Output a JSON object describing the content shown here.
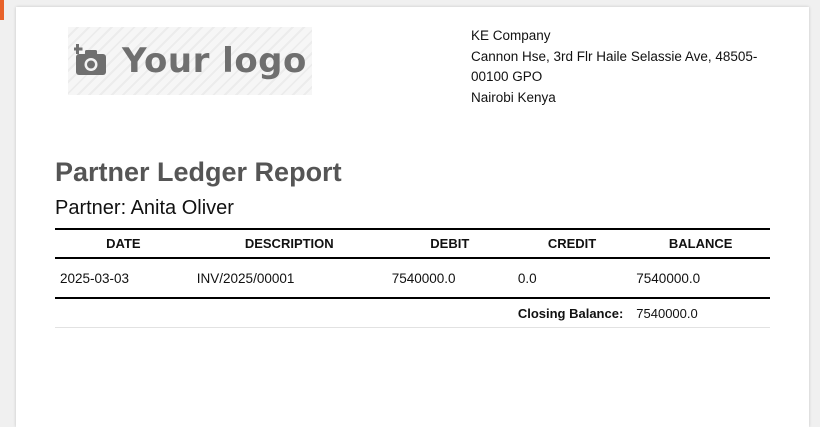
{
  "logo": {
    "text": "Your logo",
    "icon": "camera-plus-icon"
  },
  "company": {
    "name": "KE Company",
    "address_line1": "Cannon Hse, 3rd Flr Haile Selassie Ave, 48505-00100 GPO",
    "address_line2": "Nairobi Kenya"
  },
  "report": {
    "title": "Partner Ledger Report",
    "partner": "Partner: Anita Oliver"
  },
  "table": {
    "headers": [
      "DATE",
      "DESCRIPTION",
      "DEBIT",
      "CREDIT",
      "BALANCE"
    ],
    "rows": [
      {
        "date": "2025-03-03",
        "description": "INV/2025/00001",
        "debit": "7540000.0",
        "credit": "0.0",
        "balance": "7540000.0"
      }
    ],
    "closing_label": "Closing Balance:",
    "closing_value": "7540000.0"
  },
  "colors": {
    "accent": "#e8622a",
    "title": "#555555",
    "logo": "#6f6f6f"
  }
}
